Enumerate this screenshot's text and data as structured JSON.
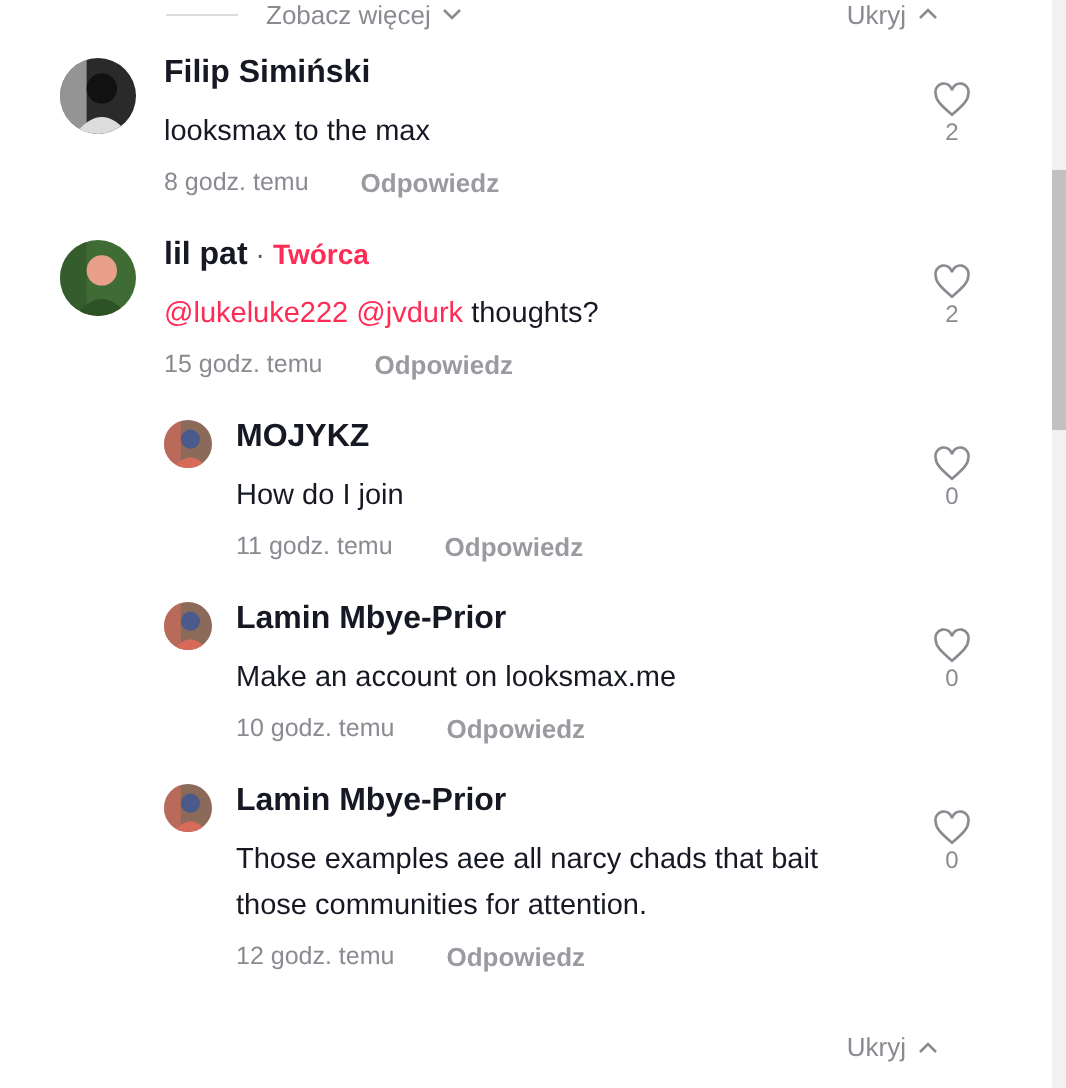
{
  "top_bar": {
    "more_label": "Zobacz więcej",
    "hide_label": "Ukryj"
  },
  "comments": [
    {
      "name": "Filip Simiński",
      "segments": [
        {
          "kind": "text",
          "text": "looksmax to the max"
        }
      ],
      "time": "8 godz. temu",
      "reply": "Odpowiedz",
      "likes": "2"
    },
    {
      "name": "lil pat",
      "badge_prefix": "·",
      "badge": "Twórca",
      "segments": [
        {
          "kind": "mention",
          "text": "@lukeluke222"
        },
        {
          "kind": "mention",
          "text": "@jvdurk"
        },
        {
          "kind": "text",
          "text": "thoughts?"
        }
      ],
      "time": "15 godz. temu",
      "reply": "Odpowiedz",
      "likes": "2",
      "children": [
        {
          "name": "MOJYKZ",
          "segments": [
            {
              "kind": "text",
              "text": "How do I join"
            }
          ],
          "time": "11 godz. temu",
          "reply": "Odpowiedz",
          "likes": "0"
        },
        {
          "name": "Lamin Mbye-Prior",
          "segments": [
            {
              "kind": "text",
              "text": "Make an account on looksmax.me"
            }
          ],
          "time": "10 godz. temu",
          "reply": "Odpowiedz",
          "likes": "0"
        },
        {
          "name": "Lamin Mbye-Prior",
          "segments": [
            {
              "kind": "text",
              "text": "Those examples aee all narcy chads that bait those communities for attention."
            }
          ],
          "time": "12 godz. temu",
          "reply": "Odpowiedz",
          "likes": "0"
        }
      ]
    }
  ],
  "bottom_bar": {
    "hide_label": "Ukryj"
  }
}
